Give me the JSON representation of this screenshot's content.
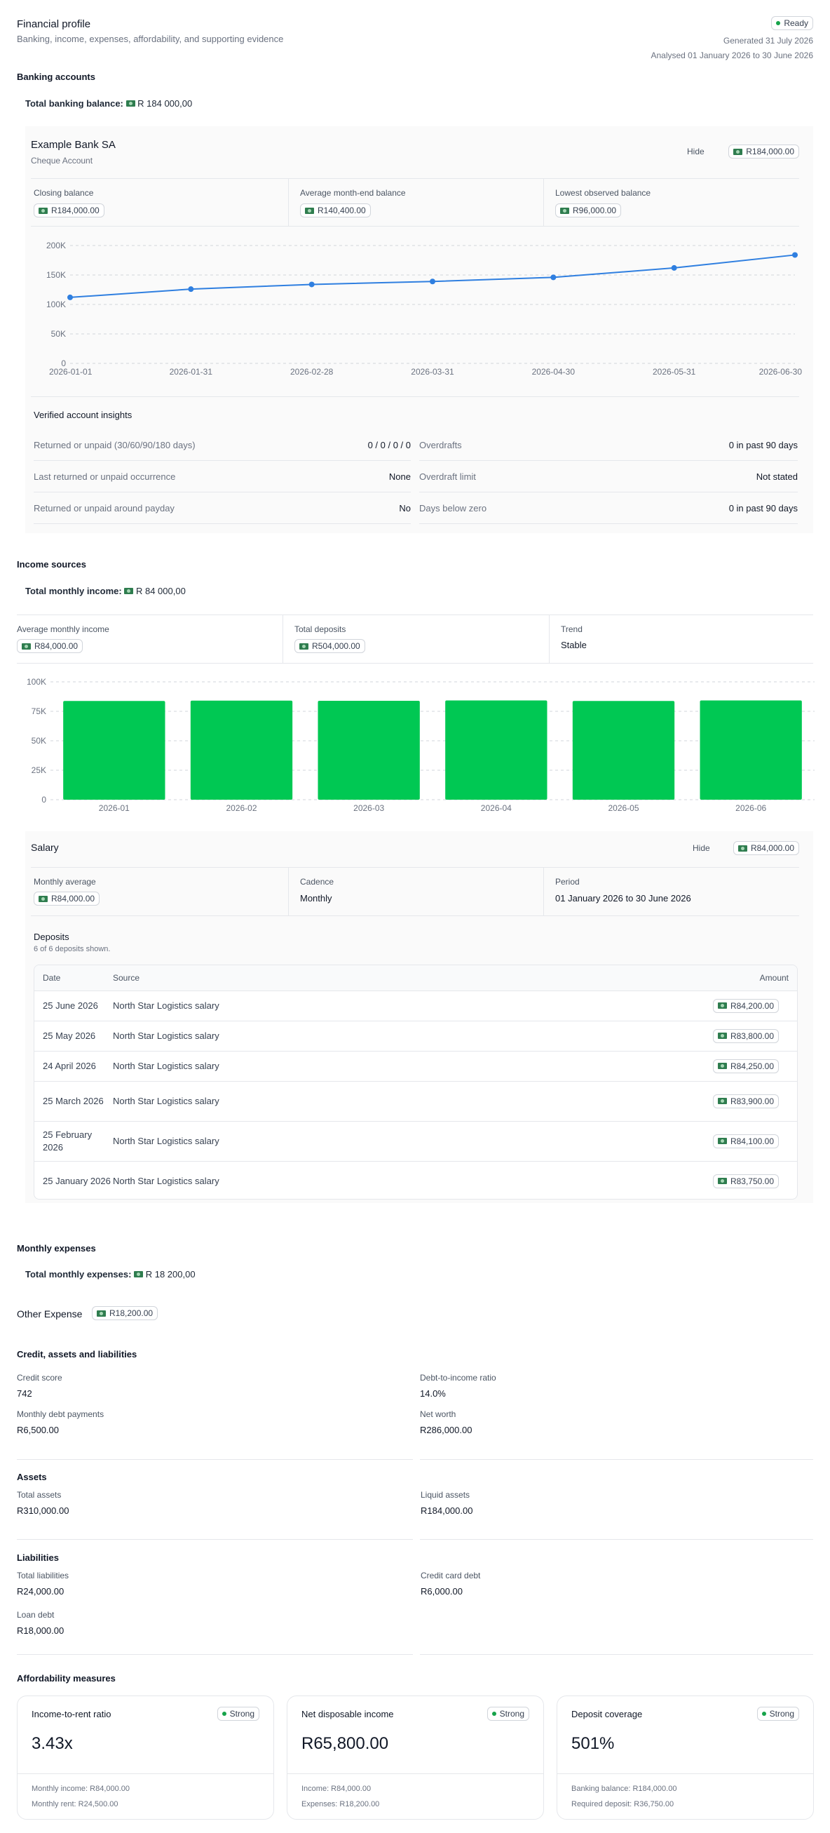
{
  "header": {
    "title": "Financial profile",
    "subtitle": "Banking, income, expenses, affordability, and supporting evidence",
    "status": "Ready",
    "generated": "Generated 31 July 2026",
    "analysed": "Analysed 01 January 2026 to 30 June 2026"
  },
  "banking": {
    "title": "Banking accounts",
    "total_label": "Total banking balance:",
    "total_value": "R 184 000,00",
    "account": {
      "bank": "Example Bank SA",
      "type": "Cheque Account",
      "hide": "Hide",
      "balance": "R184,000.00",
      "stats": [
        {
          "label": "Closing balance",
          "value": "R184,000.00"
        },
        {
          "label": "Average month-end balance",
          "value": "R140,400.00"
        },
        {
          "label": "Lowest observed balance",
          "value": "R96,000.00"
        }
      ]
    },
    "insights_title": "Verified account insights",
    "insights_left": [
      {
        "label": "Returned or unpaid (30/60/90/180 days)",
        "value": "0 / 0 / 0 / 0"
      },
      {
        "label": "Last returned or unpaid occurrence",
        "value": "None"
      },
      {
        "label": "Returned or unpaid around payday",
        "value": "No"
      }
    ],
    "insights_right": [
      {
        "label": "Overdrafts",
        "value": "0 in past 90 days"
      },
      {
        "label": "Overdraft limit",
        "value": "Not stated"
      },
      {
        "label": "Days below zero",
        "value": "0 in past 90 days"
      }
    ]
  },
  "income": {
    "title": "Income sources",
    "total_label": "Total monthly income:",
    "total_value": "R 84 000,00",
    "stats": [
      {
        "label": "Average monthly income",
        "value": "R84,000.00"
      },
      {
        "label": "Total deposits",
        "value": "R504,000.00"
      },
      {
        "label": "Trend",
        "value": "Stable"
      }
    ],
    "salary": {
      "title": "Salary",
      "hide": "Hide",
      "value": "R84,000.00",
      "stats": [
        {
          "label": "Monthly average",
          "value": "R84,000.00"
        },
        {
          "label": "Cadence",
          "value": "Monthly"
        },
        {
          "label": "Period",
          "value": "01 January 2026 to 30 June 2026"
        }
      ],
      "deposits_title": "Deposits",
      "deposits_note": "6 of 6 deposits shown.",
      "columns": [
        "Date",
        "Source",
        "Amount"
      ],
      "rows": [
        {
          "date": "25 June 2026",
          "source": "North Star Logistics salary",
          "amount": "R84,200.00"
        },
        {
          "date": "25 May 2026",
          "source": "North Star Logistics salary",
          "amount": "R83,800.00"
        },
        {
          "date": "24 April 2026",
          "source": "North Star Logistics salary",
          "amount": "R84,250.00"
        },
        {
          "date": "25 March 2026",
          "source": "North Star Logistics salary",
          "amount": "R83,900.00"
        },
        {
          "date": "25 February 2026",
          "source": "North Star Logistics salary",
          "amount": "R84,100.00"
        },
        {
          "date": "25 January 2026",
          "source": "North Star Logistics salary",
          "amount": "R83,750.00"
        }
      ]
    }
  },
  "expenses": {
    "title": "Monthly expenses",
    "total_label": "Total monthly expenses:",
    "total_value": "R 18 200,00",
    "other_label": "Other Expense",
    "other_value": "R18,200.00"
  },
  "credit": {
    "title": "Credit, assets and liabilities",
    "items": [
      {
        "label": "Credit score",
        "value": "742"
      },
      {
        "label": "Debt-to-income ratio",
        "value": "14.0%"
      },
      {
        "label": "Monthly debt payments",
        "value": "R6,500.00"
      },
      {
        "label": "Net worth",
        "value": "R286,000.00"
      }
    ],
    "assets_title": "Assets",
    "assets": [
      {
        "label": "Total assets",
        "value": "R310,000.00"
      },
      {
        "label": "Liquid assets",
        "value": "R184,000.00"
      }
    ],
    "liabilities_title": "Liabilities",
    "liabilities": [
      {
        "label": "Total liabilities",
        "value": "R24,000.00"
      },
      {
        "label": "Credit card debt",
        "value": "R6,000.00"
      },
      {
        "label": "Loan debt",
        "value": "R18,000.00"
      }
    ]
  },
  "affordability": {
    "title": "Affordability measures",
    "cards": [
      {
        "title": "Income-to-rent ratio",
        "badge": "Strong",
        "value": "3.43x",
        "line1": "Monthly income: R84,000.00",
        "line2": "Monthly rent: R24,500.00"
      },
      {
        "title": "Net disposable income",
        "badge": "Strong",
        "value": "R65,800.00",
        "line1": "Income: R84,000.00",
        "line2": "Expenses: R18,200.00"
      },
      {
        "title": "Deposit coverage",
        "badge": "Strong",
        "value": "501%",
        "line1": "Banking balance: R184,000.00",
        "line2": "Required deposit: R36,750.00"
      }
    ]
  },
  "colors": {
    "line": "#2f7fe0",
    "bar": "#00c853",
    "badge_dot": "#16a34a"
  },
  "chart_data": [
    {
      "type": "line",
      "x": [
        "2026-01-01",
        "2026-01-31",
        "2026-02-28",
        "2026-03-31",
        "2026-04-30",
        "2026-05-31",
        "2026-06-30"
      ],
      "series": [
        {
          "values": [
            112000,
            126000,
            134000,
            139000,
            146000,
            162000,
            184000
          ]
        }
      ],
      "ylim": [
        0,
        200000
      ],
      "yticks": [
        "0",
        "50K",
        "100K",
        "150K",
        "200K"
      ],
      "grid": true
    },
    {
      "type": "bar",
      "categories": [
        "2026-01",
        "2026-02",
        "2026-03",
        "2026-04",
        "2026-05",
        "2026-06"
      ],
      "values": [
        83750,
        84100,
        83900,
        84250,
        83800,
        84200
      ],
      "ylim": [
        0,
        100000
      ],
      "yticks": [
        "0",
        "25K",
        "50K",
        "75K",
        "100K"
      ],
      "grid": true
    }
  ]
}
